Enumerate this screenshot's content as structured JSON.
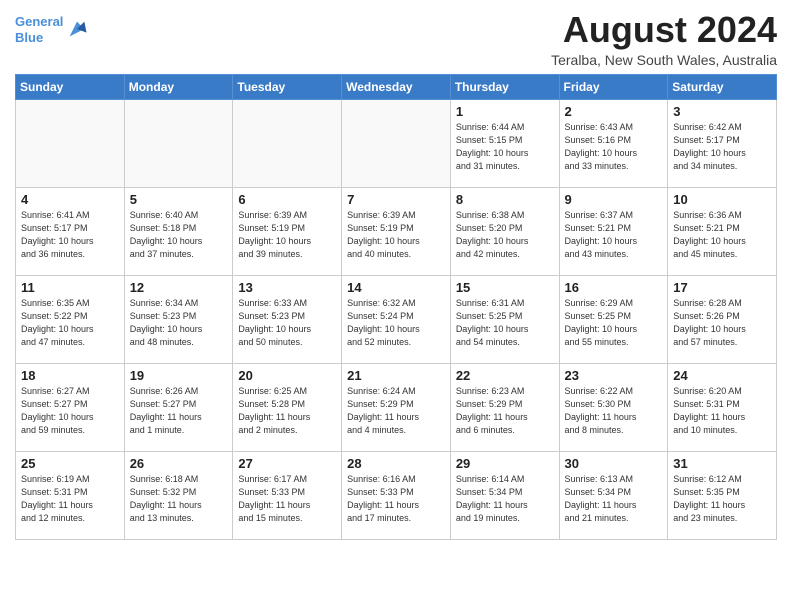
{
  "header": {
    "logo_line1": "General",
    "logo_line2": "Blue",
    "month_title": "August 2024",
    "location": "Teralba, New South Wales, Australia"
  },
  "days_of_week": [
    "Sunday",
    "Monday",
    "Tuesday",
    "Wednesday",
    "Thursday",
    "Friday",
    "Saturday"
  ],
  "weeks": [
    [
      {
        "day": "",
        "info": ""
      },
      {
        "day": "",
        "info": ""
      },
      {
        "day": "",
        "info": ""
      },
      {
        "day": "",
        "info": ""
      },
      {
        "day": "1",
        "info": "Sunrise: 6:44 AM\nSunset: 5:15 PM\nDaylight: 10 hours\nand 31 minutes."
      },
      {
        "day": "2",
        "info": "Sunrise: 6:43 AM\nSunset: 5:16 PM\nDaylight: 10 hours\nand 33 minutes."
      },
      {
        "day": "3",
        "info": "Sunrise: 6:42 AM\nSunset: 5:17 PM\nDaylight: 10 hours\nand 34 minutes."
      }
    ],
    [
      {
        "day": "4",
        "info": "Sunrise: 6:41 AM\nSunset: 5:17 PM\nDaylight: 10 hours\nand 36 minutes."
      },
      {
        "day": "5",
        "info": "Sunrise: 6:40 AM\nSunset: 5:18 PM\nDaylight: 10 hours\nand 37 minutes."
      },
      {
        "day": "6",
        "info": "Sunrise: 6:39 AM\nSunset: 5:19 PM\nDaylight: 10 hours\nand 39 minutes."
      },
      {
        "day": "7",
        "info": "Sunrise: 6:39 AM\nSunset: 5:19 PM\nDaylight: 10 hours\nand 40 minutes."
      },
      {
        "day": "8",
        "info": "Sunrise: 6:38 AM\nSunset: 5:20 PM\nDaylight: 10 hours\nand 42 minutes."
      },
      {
        "day": "9",
        "info": "Sunrise: 6:37 AM\nSunset: 5:21 PM\nDaylight: 10 hours\nand 43 minutes."
      },
      {
        "day": "10",
        "info": "Sunrise: 6:36 AM\nSunset: 5:21 PM\nDaylight: 10 hours\nand 45 minutes."
      }
    ],
    [
      {
        "day": "11",
        "info": "Sunrise: 6:35 AM\nSunset: 5:22 PM\nDaylight: 10 hours\nand 47 minutes."
      },
      {
        "day": "12",
        "info": "Sunrise: 6:34 AM\nSunset: 5:23 PM\nDaylight: 10 hours\nand 48 minutes."
      },
      {
        "day": "13",
        "info": "Sunrise: 6:33 AM\nSunset: 5:23 PM\nDaylight: 10 hours\nand 50 minutes."
      },
      {
        "day": "14",
        "info": "Sunrise: 6:32 AM\nSunset: 5:24 PM\nDaylight: 10 hours\nand 52 minutes."
      },
      {
        "day": "15",
        "info": "Sunrise: 6:31 AM\nSunset: 5:25 PM\nDaylight: 10 hours\nand 54 minutes."
      },
      {
        "day": "16",
        "info": "Sunrise: 6:29 AM\nSunset: 5:25 PM\nDaylight: 10 hours\nand 55 minutes."
      },
      {
        "day": "17",
        "info": "Sunrise: 6:28 AM\nSunset: 5:26 PM\nDaylight: 10 hours\nand 57 minutes."
      }
    ],
    [
      {
        "day": "18",
        "info": "Sunrise: 6:27 AM\nSunset: 5:27 PM\nDaylight: 10 hours\nand 59 minutes."
      },
      {
        "day": "19",
        "info": "Sunrise: 6:26 AM\nSunset: 5:27 PM\nDaylight: 11 hours\nand 1 minute."
      },
      {
        "day": "20",
        "info": "Sunrise: 6:25 AM\nSunset: 5:28 PM\nDaylight: 11 hours\nand 2 minutes."
      },
      {
        "day": "21",
        "info": "Sunrise: 6:24 AM\nSunset: 5:29 PM\nDaylight: 11 hours\nand 4 minutes."
      },
      {
        "day": "22",
        "info": "Sunrise: 6:23 AM\nSunset: 5:29 PM\nDaylight: 11 hours\nand 6 minutes."
      },
      {
        "day": "23",
        "info": "Sunrise: 6:22 AM\nSunset: 5:30 PM\nDaylight: 11 hours\nand 8 minutes."
      },
      {
        "day": "24",
        "info": "Sunrise: 6:20 AM\nSunset: 5:31 PM\nDaylight: 11 hours\nand 10 minutes."
      }
    ],
    [
      {
        "day": "25",
        "info": "Sunrise: 6:19 AM\nSunset: 5:31 PM\nDaylight: 11 hours\nand 12 minutes."
      },
      {
        "day": "26",
        "info": "Sunrise: 6:18 AM\nSunset: 5:32 PM\nDaylight: 11 hours\nand 13 minutes."
      },
      {
        "day": "27",
        "info": "Sunrise: 6:17 AM\nSunset: 5:33 PM\nDaylight: 11 hours\nand 15 minutes."
      },
      {
        "day": "28",
        "info": "Sunrise: 6:16 AM\nSunset: 5:33 PM\nDaylight: 11 hours\nand 17 minutes."
      },
      {
        "day": "29",
        "info": "Sunrise: 6:14 AM\nSunset: 5:34 PM\nDaylight: 11 hours\nand 19 minutes."
      },
      {
        "day": "30",
        "info": "Sunrise: 6:13 AM\nSunset: 5:34 PM\nDaylight: 11 hours\nand 21 minutes."
      },
      {
        "day": "31",
        "info": "Sunrise: 6:12 AM\nSunset: 5:35 PM\nDaylight: 11 hours\nand 23 minutes."
      }
    ]
  ]
}
